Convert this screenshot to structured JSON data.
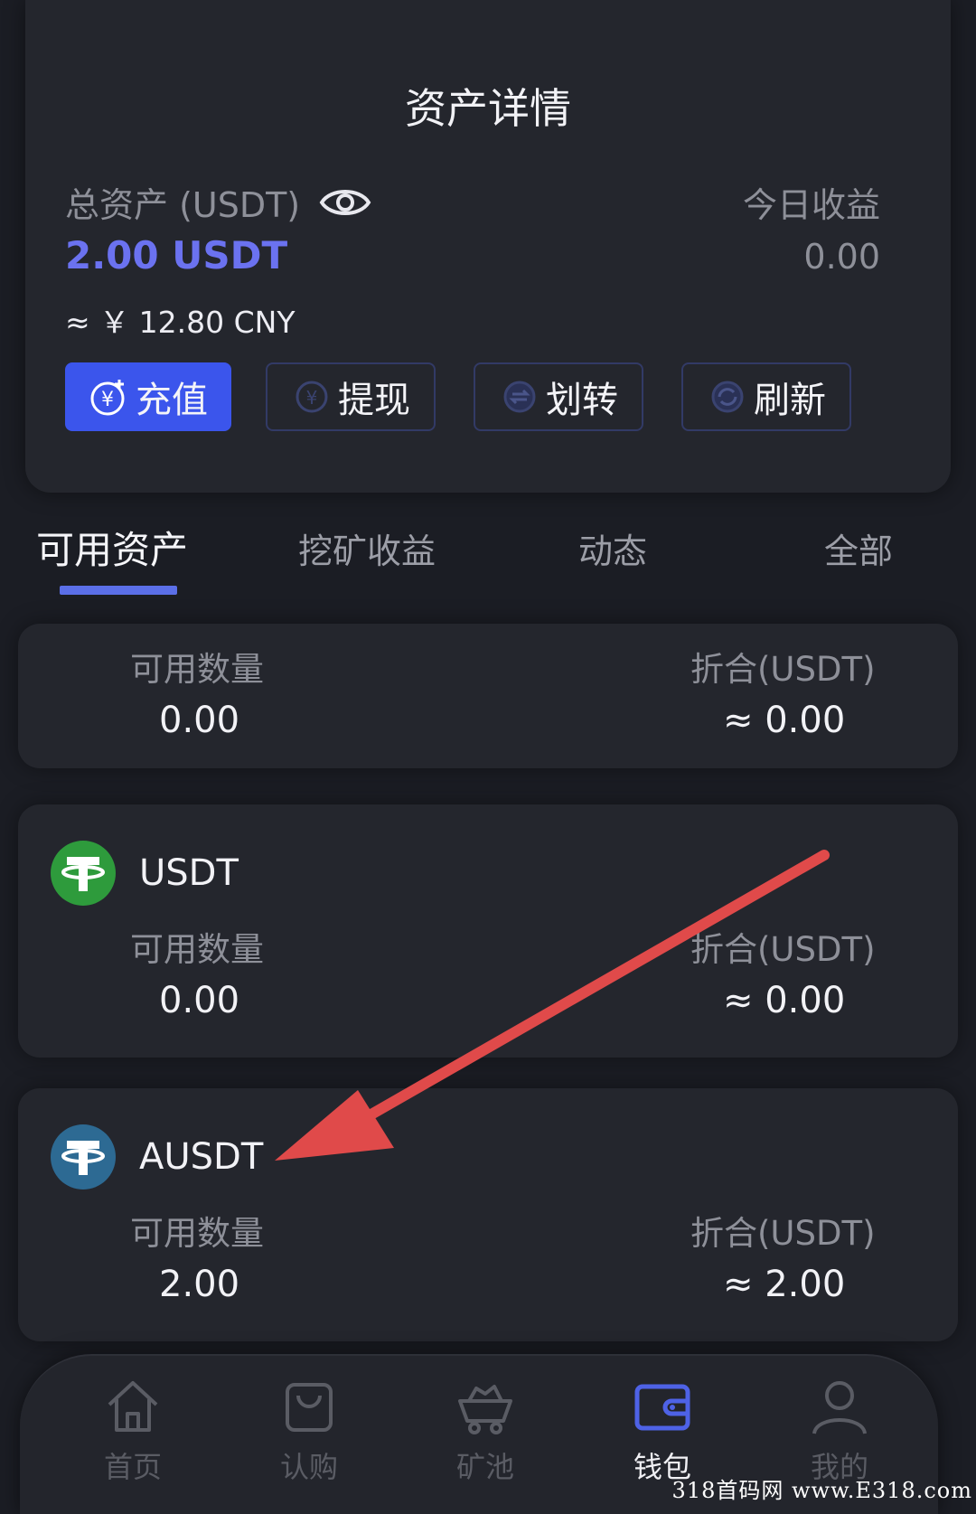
{
  "header": {
    "title": "资产详情",
    "total_label": "总资产 (USDT)",
    "total_value": "2.00 USDT",
    "approx_value": "≈ ￥ 12.80 CNY",
    "today_label": "今日收益",
    "today_value": "0.00"
  },
  "actions": {
    "recharge": "充值",
    "withdraw": "提现",
    "transfer": "划转",
    "refresh": "刷新"
  },
  "tabs": [
    "可用资产",
    "挖矿收益",
    "动态",
    "全部"
  ],
  "summary": {
    "qty_label": "可用数量",
    "qty_value": "0.00",
    "equiv_label": "折合(USDT)",
    "equiv_value": "≈ 0.00"
  },
  "coins": [
    {
      "name": "USDT",
      "icon": "tether-green-icon",
      "icon_color": "#2e9b3c",
      "qty_label": "可用数量",
      "qty_value": "0.00",
      "equiv_label": "折合(USDT)",
      "equiv_value": "≈ 0.00"
    },
    {
      "name": "AUSDT",
      "icon": "tether-blue-icon",
      "icon_color": "#2d6a93",
      "qty_label": "可用数量",
      "qty_value": "2.00",
      "equiv_label": "折合(USDT)",
      "equiv_value": "≈ 2.00"
    }
  ],
  "nav": [
    {
      "label": "首页",
      "icon": "home-icon",
      "active": false
    },
    {
      "label": "认购",
      "icon": "shopping-bag-icon",
      "active": false
    },
    {
      "label": "矿池",
      "icon": "mine-cart-icon",
      "active": false
    },
    {
      "label": "钱包",
      "icon": "wallet-icon",
      "active": true
    },
    {
      "label": "我的",
      "icon": "user-icon",
      "active": false
    }
  ],
  "colors": {
    "accent": "#3b55ec",
    "total_value": "#6b72f0",
    "annotation_arrow": "#e04a4a"
  },
  "watermark": "318首码网 www.E318.com"
}
